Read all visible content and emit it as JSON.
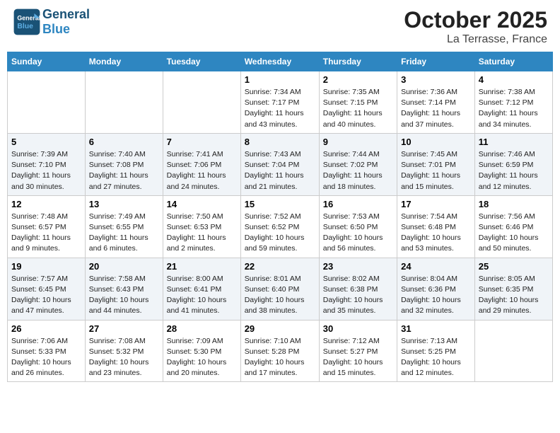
{
  "header": {
    "logo_general": "General",
    "logo_blue": "Blue",
    "title": "October 2025",
    "subtitle": "La Terrasse, France"
  },
  "weekdays": [
    "Sunday",
    "Monday",
    "Tuesday",
    "Wednesday",
    "Thursday",
    "Friday",
    "Saturday"
  ],
  "weeks": [
    [
      {
        "day": "",
        "info": ""
      },
      {
        "day": "",
        "info": ""
      },
      {
        "day": "",
        "info": ""
      },
      {
        "day": "1",
        "info": "Sunrise: 7:34 AM\nSunset: 7:17 PM\nDaylight: 11 hours and 43 minutes."
      },
      {
        "day": "2",
        "info": "Sunrise: 7:35 AM\nSunset: 7:15 PM\nDaylight: 11 hours and 40 minutes."
      },
      {
        "day": "3",
        "info": "Sunrise: 7:36 AM\nSunset: 7:14 PM\nDaylight: 11 hours and 37 minutes."
      },
      {
        "day": "4",
        "info": "Sunrise: 7:38 AM\nSunset: 7:12 PM\nDaylight: 11 hours and 34 minutes."
      }
    ],
    [
      {
        "day": "5",
        "info": "Sunrise: 7:39 AM\nSunset: 7:10 PM\nDaylight: 11 hours and 30 minutes."
      },
      {
        "day": "6",
        "info": "Sunrise: 7:40 AM\nSunset: 7:08 PM\nDaylight: 11 hours and 27 minutes."
      },
      {
        "day": "7",
        "info": "Sunrise: 7:41 AM\nSunset: 7:06 PM\nDaylight: 11 hours and 24 minutes."
      },
      {
        "day": "8",
        "info": "Sunrise: 7:43 AM\nSunset: 7:04 PM\nDaylight: 11 hours and 21 minutes."
      },
      {
        "day": "9",
        "info": "Sunrise: 7:44 AM\nSunset: 7:02 PM\nDaylight: 11 hours and 18 minutes."
      },
      {
        "day": "10",
        "info": "Sunrise: 7:45 AM\nSunset: 7:01 PM\nDaylight: 11 hours and 15 minutes."
      },
      {
        "day": "11",
        "info": "Sunrise: 7:46 AM\nSunset: 6:59 PM\nDaylight: 11 hours and 12 minutes."
      }
    ],
    [
      {
        "day": "12",
        "info": "Sunrise: 7:48 AM\nSunset: 6:57 PM\nDaylight: 11 hours and 9 minutes."
      },
      {
        "day": "13",
        "info": "Sunrise: 7:49 AM\nSunset: 6:55 PM\nDaylight: 11 hours and 6 minutes."
      },
      {
        "day": "14",
        "info": "Sunrise: 7:50 AM\nSunset: 6:53 PM\nDaylight: 11 hours and 2 minutes."
      },
      {
        "day": "15",
        "info": "Sunrise: 7:52 AM\nSunset: 6:52 PM\nDaylight: 10 hours and 59 minutes."
      },
      {
        "day": "16",
        "info": "Sunrise: 7:53 AM\nSunset: 6:50 PM\nDaylight: 10 hours and 56 minutes."
      },
      {
        "day": "17",
        "info": "Sunrise: 7:54 AM\nSunset: 6:48 PM\nDaylight: 10 hours and 53 minutes."
      },
      {
        "day": "18",
        "info": "Sunrise: 7:56 AM\nSunset: 6:46 PM\nDaylight: 10 hours and 50 minutes."
      }
    ],
    [
      {
        "day": "19",
        "info": "Sunrise: 7:57 AM\nSunset: 6:45 PM\nDaylight: 10 hours and 47 minutes."
      },
      {
        "day": "20",
        "info": "Sunrise: 7:58 AM\nSunset: 6:43 PM\nDaylight: 10 hours and 44 minutes."
      },
      {
        "day": "21",
        "info": "Sunrise: 8:00 AM\nSunset: 6:41 PM\nDaylight: 10 hours and 41 minutes."
      },
      {
        "day": "22",
        "info": "Sunrise: 8:01 AM\nSunset: 6:40 PM\nDaylight: 10 hours and 38 minutes."
      },
      {
        "day": "23",
        "info": "Sunrise: 8:02 AM\nSunset: 6:38 PM\nDaylight: 10 hours and 35 minutes."
      },
      {
        "day": "24",
        "info": "Sunrise: 8:04 AM\nSunset: 6:36 PM\nDaylight: 10 hours and 32 minutes."
      },
      {
        "day": "25",
        "info": "Sunrise: 8:05 AM\nSunset: 6:35 PM\nDaylight: 10 hours and 29 minutes."
      }
    ],
    [
      {
        "day": "26",
        "info": "Sunrise: 7:06 AM\nSunset: 5:33 PM\nDaylight: 10 hours and 26 minutes."
      },
      {
        "day": "27",
        "info": "Sunrise: 7:08 AM\nSunset: 5:32 PM\nDaylight: 10 hours and 23 minutes."
      },
      {
        "day": "28",
        "info": "Sunrise: 7:09 AM\nSunset: 5:30 PM\nDaylight: 10 hours and 20 minutes."
      },
      {
        "day": "29",
        "info": "Sunrise: 7:10 AM\nSunset: 5:28 PM\nDaylight: 10 hours and 17 minutes."
      },
      {
        "day": "30",
        "info": "Sunrise: 7:12 AM\nSunset: 5:27 PM\nDaylight: 10 hours and 15 minutes."
      },
      {
        "day": "31",
        "info": "Sunrise: 7:13 AM\nSunset: 5:25 PM\nDaylight: 10 hours and 12 minutes."
      },
      {
        "day": "",
        "info": ""
      }
    ]
  ]
}
